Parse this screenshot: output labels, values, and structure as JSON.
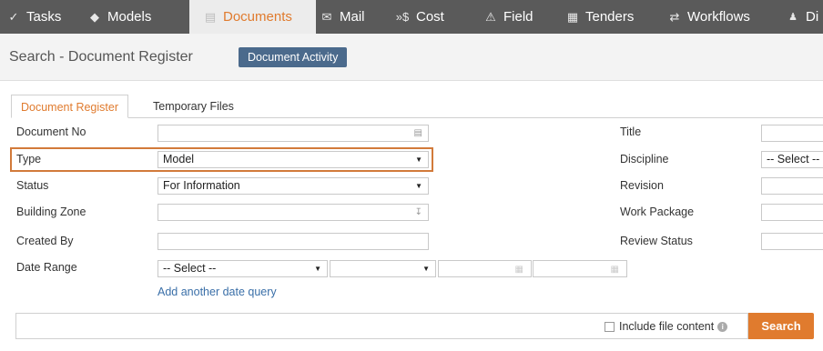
{
  "nav": {
    "items": [
      {
        "icon": "check-icon",
        "glyph": "✓",
        "label": "Tasks"
      },
      {
        "icon": "cube-icon",
        "glyph": "◆",
        "label": "Models"
      },
      {
        "icon": "document-icon",
        "glyph": "▤",
        "label": "Documents"
      },
      {
        "icon": "mail-icon",
        "glyph": "✉",
        "label": "Mail"
      },
      {
        "icon": "cost-icon",
        "glyph": "»$",
        "label": "Cost"
      },
      {
        "icon": "warning-icon",
        "glyph": "⚠",
        "label": "Field"
      },
      {
        "icon": "tender-icon",
        "glyph": "▦",
        "label": "Tenders"
      },
      {
        "icon": "workflow-icon",
        "glyph": "⇄",
        "label": "Workflows"
      },
      {
        "icon": "people-icon",
        "glyph": "👥",
        "label": "Di"
      }
    ],
    "active": "Documents"
  },
  "header": {
    "title": "Search - Document Register",
    "activity_button": "Document Activity"
  },
  "tabs": [
    "Document Register",
    "Temporary Files"
  ],
  "form": {
    "document_no": {
      "label": "Document No",
      "value": ""
    },
    "type": {
      "label": "Type",
      "value": "Model"
    },
    "status": {
      "label": "Status",
      "value": "For Information"
    },
    "building_zone": {
      "label": "Building Zone",
      "value": ""
    },
    "created_by": {
      "label": "Created By",
      "value": ""
    },
    "date_range": {
      "label": "Date Range",
      "select_value": "-- Select --",
      "second_value": "",
      "from": "",
      "to": ""
    },
    "add_date_link": "Add another date query",
    "title": {
      "label": "Title",
      "value": ""
    },
    "discipline": {
      "label": "Discipline",
      "value": "-- Select --"
    },
    "revision": {
      "label": "Revision",
      "value": ""
    },
    "work_package": {
      "label": "Work Package",
      "value": ""
    },
    "review_status": {
      "label": "Review Status",
      "value": ""
    }
  },
  "search": {
    "input_value": "",
    "include_file_content": "Include file content",
    "button": "Search"
  },
  "colors": {
    "nav_bg": "#5a5a5a",
    "accent": "#e07b2e",
    "activity_button": "#4b6a8c",
    "link": "#3a6fa8"
  }
}
